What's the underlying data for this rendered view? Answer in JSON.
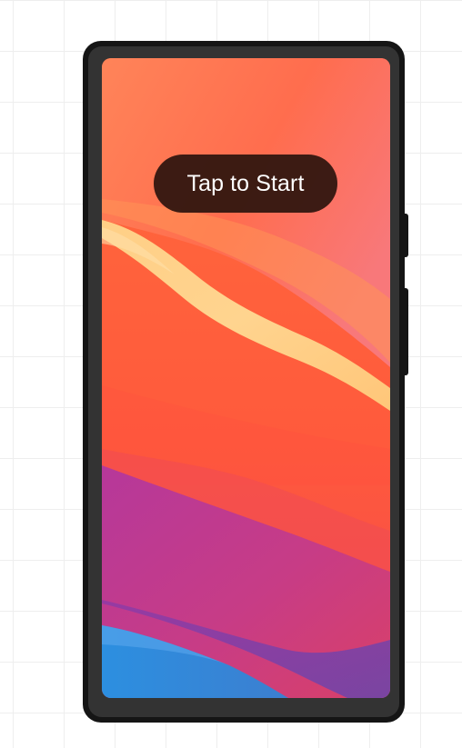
{
  "start_button": {
    "label": "Tap to Start"
  },
  "colors": {
    "device_frame": "#151515",
    "device_bezel": "#333333",
    "button_bg": "#2d140e",
    "button_text": "#ffffff",
    "wallpaper_orange": "#ff6a3a",
    "wallpaper_peach": "#ffd88c",
    "wallpaper_magenta": "#b43893",
    "wallpaper_blue": "#3490d8"
  }
}
